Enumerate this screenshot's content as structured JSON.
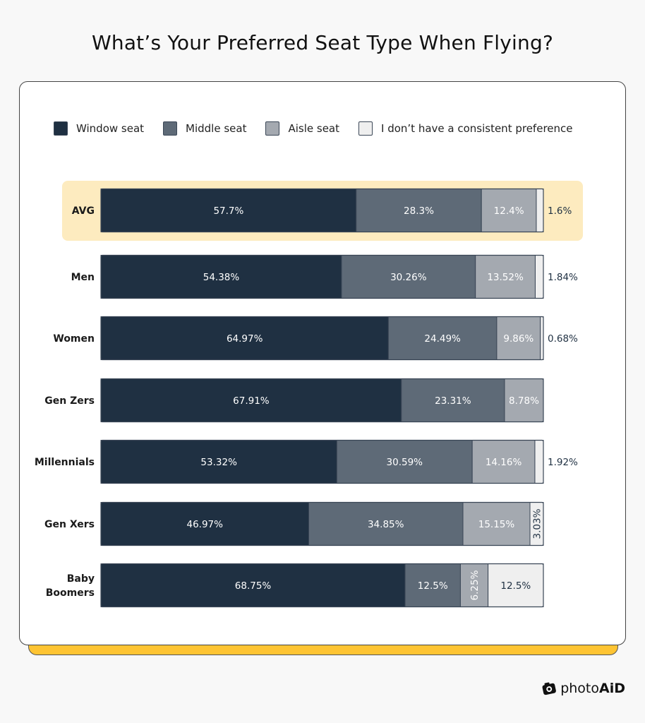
{
  "title": "What’s Your Preferred Seat Type When Flying?",
  "brand": {
    "prefix": "photo",
    "suffix": "AiD",
    "icon": "camera-icon"
  },
  "colors": {
    "window": "#1f3042",
    "middle": "#5e6a77",
    "aisle": "#a4a9b0",
    "none": "#efefef",
    "highlight": "#fdebbf",
    "accent": "#fec433"
  },
  "chart_data": {
    "type": "bar",
    "orientation": "horizontal",
    "stacked": true,
    "title": "What’s Your Preferred Seat Type When Flying?",
    "xlabel": "",
    "ylabel": "",
    "xlim": [
      0,
      100
    ],
    "grid": false,
    "legend_position": "top",
    "highlighted_category": "AVG",
    "categories": [
      "AVG",
      "Men",
      "Women",
      "Gen Zers",
      "Millennials",
      "Gen Xers",
      "Baby Boomers"
    ],
    "series": [
      {
        "name": "Window seat",
        "values": [
          57.7,
          54.38,
          64.97,
          67.91,
          53.32,
          46.97,
          68.75
        ],
        "labels": [
          "57.7%",
          "54.38%",
          "64.97%",
          "67.91%",
          "53.32%",
          "46.97%",
          "68.75%"
        ]
      },
      {
        "name": "Middle seat",
        "values": [
          28.3,
          30.26,
          24.49,
          23.31,
          30.59,
          34.85,
          12.5
        ],
        "labels": [
          "28.3%",
          "30.26%",
          "24.49%",
          "23.31%",
          "30.59%",
          "34.85%",
          "12.5%"
        ]
      },
      {
        "name": "Aisle seat",
        "values": [
          12.4,
          13.52,
          9.86,
          8.78,
          14.16,
          15.15,
          6.25
        ],
        "labels": [
          "12.4%",
          "13.52%",
          "9.86%",
          "8.78%",
          "14.16%",
          "15.15%",
          "6.25%"
        ]
      },
      {
        "name": "I don’t have a consistent preference",
        "values": [
          1.6,
          1.84,
          0.68,
          0,
          1.92,
          3.03,
          12.5
        ],
        "labels": [
          "1.6%",
          "1.84%",
          "0.68%",
          "",
          "1.92%",
          "3.03%",
          "12.5%"
        ]
      }
    ]
  }
}
